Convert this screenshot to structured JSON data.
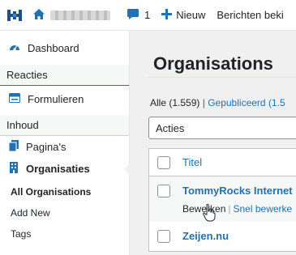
{
  "adminbar": {
    "comment_count": "1",
    "new_label": "Nieuw",
    "messages_label": "Berichten beki"
  },
  "sidebar": {
    "dashboard": "Dashboard",
    "section_reacties": "Reacties",
    "formulieren": "Formulieren",
    "section_inhoud": "Inhoud",
    "paginas": "Pagina's",
    "organisaties": "Organisaties",
    "submenu": [
      "All Organisations",
      "Add New",
      "Tags"
    ]
  },
  "main": {
    "title": "Organisations",
    "filter_all": "Alle",
    "filter_all_count": "(1.559)",
    "filter_sep": "|",
    "filter_published": "Gepubliceerd",
    "filter_published_count": "(1.5",
    "actions_select": "Acties",
    "column_title": "Titel",
    "rows": [
      {
        "title": "TommyRocks Internet",
        "edit": "Bewerken",
        "sep": "|",
        "quick_edit": "Snel bewerke"
      },
      {
        "title": "Zeijen.nu"
      }
    ]
  },
  "colors": {
    "link": "#2271b1",
    "admin_icon": "#2271b1",
    "reacties_accent": "#b6338a",
    "inhoud_accent": "#c8dd9c"
  }
}
